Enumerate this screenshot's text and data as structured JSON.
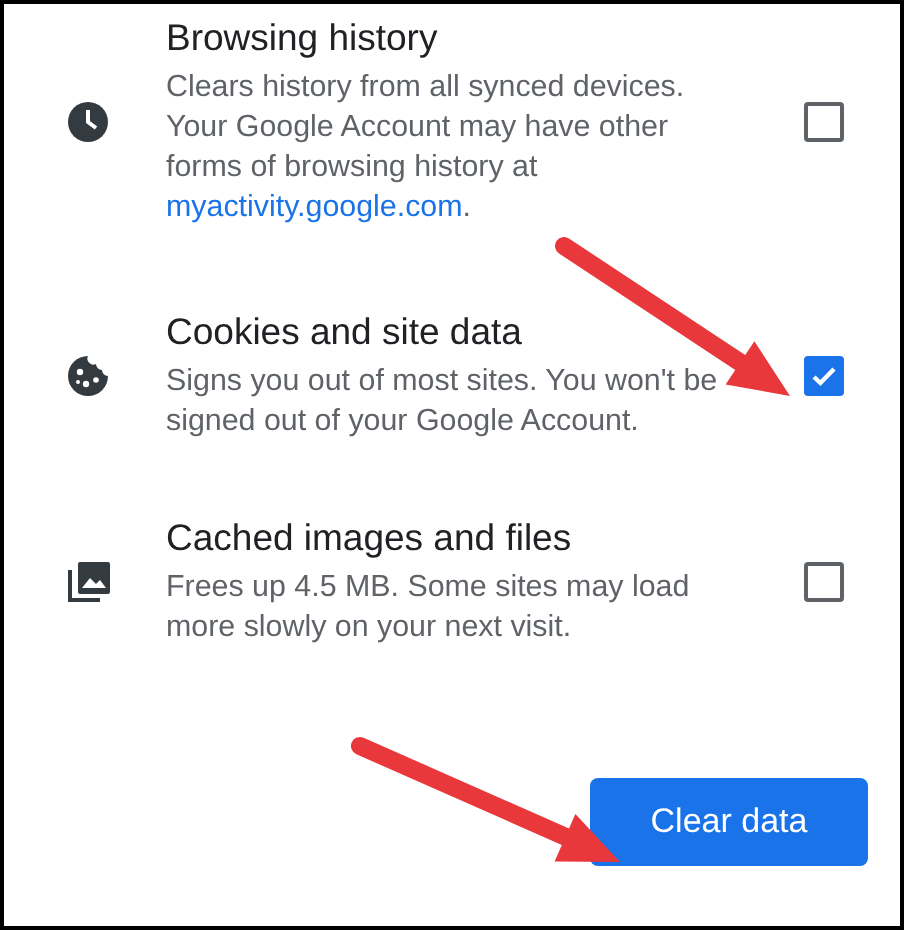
{
  "options": [
    {
      "kind": "history",
      "title": "Browsing history",
      "description": {
        "text": "Clears history from all synced devices. Your Google Account may have other forms of browsing history at ",
        "link": "myactivity.google.com",
        "after": "."
      },
      "checked": false,
      "arrow": false
    },
    {
      "kind": "cookies",
      "title": "Cookies and site data",
      "description": {
        "text": "Signs you out of most sites. You won't be signed out of your Google Account."
      },
      "checked": true,
      "arrow": true
    },
    {
      "kind": "cache",
      "title": "Cached images and files",
      "description": {
        "text": "Frees up 4.5 MB. Some sites may load more slowly on your next visit."
      },
      "checked": false,
      "arrow": false
    }
  ],
  "button": {
    "label": "Clear data",
    "arrow": true
  }
}
